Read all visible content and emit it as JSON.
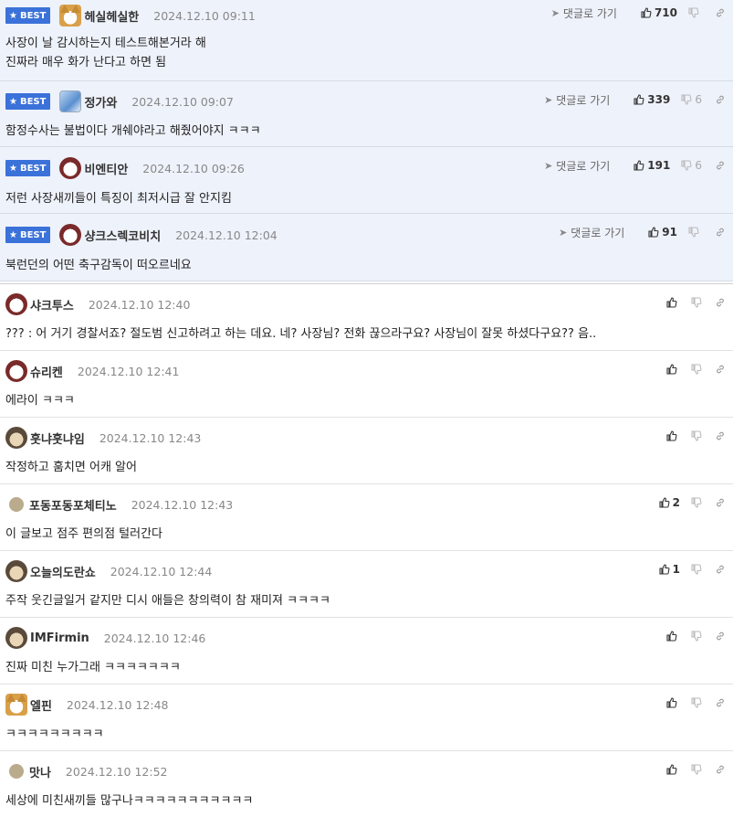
{
  "labels": {
    "best": "BEST",
    "reply": "댓글로 가기"
  },
  "best_comments": [
    {
      "nick": "헤실헤실한",
      "date": "2024.12.10 09:11",
      "up": "710",
      "down": "",
      "avatar": "fox-icon",
      "lines": [
        "사장이 날 감시하는지 테스트해본거라 해",
        "진짜라 매우 화가 난다고 하면 됨"
      ]
    },
    {
      "nick": "정가와",
      "date": "2024.12.10 09:07",
      "up": "339",
      "down": "6",
      "avatar": "blue-avatar-icon",
      "lines": [
        "함정수사는 불법이다 개쉐야라고 해줬어야지 ㅋㅋㅋ"
      ]
    },
    {
      "nick": "비엔티안",
      "date": "2024.12.10 09:26",
      "up": "191",
      "down": "6",
      "avatar": "dog-icon",
      "lines": [
        "저런 사장새끼들이 특징이 최저시급 잘 안지킴"
      ]
    },
    {
      "nick": "샹크스렉코비치",
      "date": "2024.12.10 12:04",
      "up": "91",
      "down": "",
      "avatar": "dog-icon",
      "lines": [
        "북런던의 어떤 축구감독이 떠오르네요"
      ]
    }
  ],
  "comments": [
    {
      "nick": "샤크투스",
      "date": "2024.12.10 12:40",
      "up": "",
      "avatar": "dog-icon",
      "text": "??? : 어 거기 경찰서죠? 절도범 신고하려고 하는 데요. 네? 사장님? 전화 끊으라구요? 사장님이 잘못 하셨다구요?? 음.."
    },
    {
      "nick": "슈리켄",
      "date": "2024.12.10 12:41",
      "up": "",
      "avatar": "dog-icon",
      "text": "에라이 ㅋㅋㅋ"
    },
    {
      "nick": "훗냐훗냐임",
      "date": "2024.12.10 12:43",
      "up": "",
      "avatar": "pug-icon",
      "text": "작정하고 훔치면 어캐 알어"
    },
    {
      "nick": "포동포동포체티노",
      "date": "2024.12.10 12:43",
      "up": "2",
      "avatar": "dot-avatar-icon",
      "text": "이 글보고 점주 편의점 털러간다"
    },
    {
      "nick": "오늘의도란쇼",
      "date": "2024.12.10 12:44",
      "up": "1",
      "avatar": "pug-icon",
      "text": "주작 웃긴글일거 같지만 디시 애들은 창의력이 참 재미져 ㅋㅋㅋㅋ"
    },
    {
      "nick": "IMFirmin",
      "date": "2024.12.10 12:46",
      "up": "",
      "avatar": "pug-icon",
      "text": "진짜 미친 누가그래 ㅋㅋㅋㅋㅋㅋㅋ"
    },
    {
      "nick": "엘핀",
      "date": "2024.12.10 12:48",
      "up": "",
      "avatar": "fox-icon",
      "text": "ㅋㅋㅋㅋㅋㅋㅋㅋㅋ"
    },
    {
      "nick": "맛나",
      "date": "2024.12.10 12:52",
      "up": "",
      "avatar": "dot-avatar-icon",
      "text": "세상에 미친새끼들 많구나ㅋㅋㅋㅋㅋㅋㅋㅋㅋㅋㅋ"
    }
  ]
}
